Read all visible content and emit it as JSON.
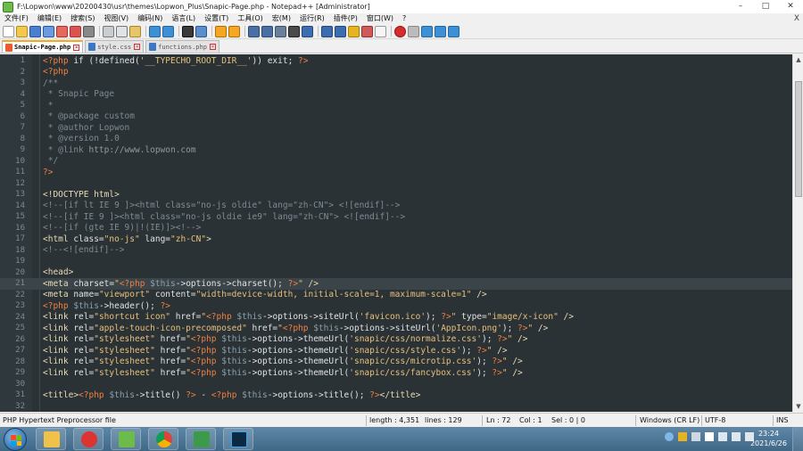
{
  "window": {
    "title": "F:\\Lopwon\\www\\20200430\\usr\\themes\\Lopwon_Plus\\Snapic-Page.php - Notepad++ [Administrator]",
    "minimize": "–",
    "maximize": "□",
    "close": "✕"
  },
  "menu": {
    "items": [
      "文件(F)",
      "编辑(E)",
      "搜索(S)",
      "视图(V)",
      "编码(N)",
      "语言(L)",
      "设置(T)",
      "工具(O)",
      "宏(M)",
      "运行(R)",
      "插件(P)",
      "窗口(W)",
      "?"
    ],
    "close": "X"
  },
  "tabs": [
    {
      "label": "Snapic-Page.php",
      "active": true,
      "icon_color": "#e85c30"
    },
    {
      "label": "style.css",
      "active": false,
      "icon_color": "#3b78c4"
    },
    {
      "label": "functions.php",
      "active": false,
      "icon_color": "#3b78c4"
    }
  ],
  "editor": {
    "current_line": 21,
    "lines": [
      {
        "n": "1",
        "segs": [
          [
            "<?php",
            "#f08040"
          ],
          [
            " if (!defined(",
            "#e0e2e4"
          ],
          [
            "'__TYPECHO_ROOT_DIR__'",
            "#e6c07b"
          ],
          [
            ")) exit; ",
            "#e0e2e4"
          ],
          [
            "?>",
            "#f08040"
          ]
        ]
      },
      {
        "n": "2",
        "segs": [
          [
            "<?php",
            "#f08040"
          ]
        ]
      },
      {
        "n": "3",
        "segs": [
          [
            "/**",
            "#7d8b94"
          ]
        ]
      },
      {
        "n": "4",
        "segs": [
          [
            " * Snapic Page",
            "#7d8b94"
          ]
        ]
      },
      {
        "n": "5",
        "segs": [
          [
            " *",
            "#7d8b94"
          ]
        ]
      },
      {
        "n": "6",
        "segs": [
          [
            " * @package custom",
            "#7d8b94"
          ]
        ]
      },
      {
        "n": "7",
        "segs": [
          [
            " * @author Lopwon",
            "#7d8b94"
          ]
        ]
      },
      {
        "n": "8",
        "segs": [
          [
            " * @version 1.0",
            "#7d8b94"
          ]
        ]
      },
      {
        "n": "9",
        "segs": [
          [
            " * @link ",
            "#7d8b94"
          ],
          [
            "http://www.lopwon.com",
            "#8c9aa3"
          ]
        ]
      },
      {
        "n": "10",
        "segs": [
          [
            " */",
            "#7d8b94"
          ]
        ]
      },
      {
        "n": "11",
        "segs": [
          [
            "?>",
            "#f08040"
          ]
        ]
      },
      {
        "n": "12",
        "segs": []
      },
      {
        "n": "13",
        "segs": [
          [
            "<!DOCTYPE html>",
            "#e8dcb5"
          ]
        ]
      },
      {
        "n": "14",
        "segs": [
          [
            "<!--[if lt IE 9 ]><html class=\"no-js oldie\" lang=\"zh-CN\"> <![endif]-->",
            "#7d8b94"
          ]
        ]
      },
      {
        "n": "15",
        "segs": [
          [
            "<!--[if IE 9 ]><html class=\"no-js oldie ie9\" lang=\"zh-CN\"> <![endif]-->",
            "#7d8b94"
          ]
        ]
      },
      {
        "n": "16",
        "segs": [
          [
            "<!--[if (gte IE 9)|!(IE)]><!-->",
            "#7d8b94"
          ]
        ]
      },
      {
        "n": "17",
        "segs": [
          [
            "<html ",
            "#e8dcb5"
          ],
          [
            "class=",
            "#e0e2e4"
          ],
          [
            "\"no-js\"",
            "#e6c07b"
          ],
          [
            " lang=",
            "#e0e2e4"
          ],
          [
            "\"zh-CN\"",
            "#e6c07b"
          ],
          [
            ">",
            "#e8dcb5"
          ]
        ]
      },
      {
        "n": "18",
        "segs": [
          [
            "<!--<![endif]-->",
            "#7d8b94"
          ]
        ]
      },
      {
        "n": "19",
        "segs": []
      },
      {
        "n": "20",
        "segs": [
          [
            "<head>",
            "#e8dcb5"
          ]
        ]
      },
      {
        "n": "21",
        "segs": [
          [
            "<meta ",
            "#e8dcb5"
          ],
          [
            "charset=",
            "#e0e2e4"
          ],
          [
            "\"",
            "#e6c07b"
          ],
          [
            "<?php",
            "#f08040"
          ],
          [
            " $this",
            "#8aa0ad"
          ],
          [
            "->options->charset(); ",
            "#e0e2e4"
          ],
          [
            "?>",
            "#f08040"
          ],
          [
            "\"",
            "#e6c07b"
          ],
          [
            " />",
            "#e8dcb5"
          ]
        ]
      },
      {
        "n": "22",
        "segs": [
          [
            "<meta ",
            "#e8dcb5"
          ],
          [
            "name=",
            "#e0e2e4"
          ],
          [
            "\"viewport\"",
            "#e6c07b"
          ],
          [
            " content=",
            "#e0e2e4"
          ],
          [
            "\"width=device-width, initial-scale=1, maximum-scale=1\"",
            "#e6c07b"
          ],
          [
            " />",
            "#e8dcb5"
          ]
        ]
      },
      {
        "n": "23",
        "segs": [
          [
            "<?php",
            "#f08040"
          ],
          [
            " $this",
            "#8aa0ad"
          ],
          [
            "->header(); ",
            "#e0e2e4"
          ],
          [
            "?>",
            "#f08040"
          ]
        ]
      },
      {
        "n": "24",
        "segs": [
          [
            "<link ",
            "#e8dcb5"
          ],
          [
            "rel=",
            "#e0e2e4"
          ],
          [
            "\"shortcut icon\"",
            "#e6c07b"
          ],
          [
            " href=",
            "#e0e2e4"
          ],
          [
            "\"",
            "#e6c07b"
          ],
          [
            "<?php",
            "#f08040"
          ],
          [
            " $this",
            "#8aa0ad"
          ],
          [
            "->options->siteUrl(",
            "#e0e2e4"
          ],
          [
            "'favicon.ico'",
            "#e6c07b"
          ],
          [
            "); ",
            "#e0e2e4"
          ],
          [
            "?>",
            "#f08040"
          ],
          [
            "\"",
            "#e6c07b"
          ],
          [
            " type=",
            "#e0e2e4"
          ],
          [
            "\"image/x-icon\"",
            "#e6c07b"
          ],
          [
            " />",
            "#e8dcb5"
          ]
        ]
      },
      {
        "n": "25",
        "segs": [
          [
            "<link ",
            "#e8dcb5"
          ],
          [
            "rel=",
            "#e0e2e4"
          ],
          [
            "\"apple-touch-icon-precomposed\"",
            "#e6c07b"
          ],
          [
            " href=",
            "#e0e2e4"
          ],
          [
            "\"",
            "#e6c07b"
          ],
          [
            "<?php",
            "#f08040"
          ],
          [
            " $this",
            "#8aa0ad"
          ],
          [
            "->options->siteUrl(",
            "#e0e2e4"
          ],
          [
            "'AppIcon.png'",
            "#e6c07b"
          ],
          [
            "); ",
            "#e0e2e4"
          ],
          [
            "?>",
            "#f08040"
          ],
          [
            "\"",
            "#e6c07b"
          ],
          [
            " />",
            "#e8dcb5"
          ]
        ]
      },
      {
        "n": "26",
        "segs": [
          [
            "<link ",
            "#e8dcb5"
          ],
          [
            "rel=",
            "#e0e2e4"
          ],
          [
            "\"stylesheet\"",
            "#e6c07b"
          ],
          [
            " href=",
            "#e0e2e4"
          ],
          [
            "\"",
            "#e6c07b"
          ],
          [
            "<?php",
            "#f08040"
          ],
          [
            " $this",
            "#8aa0ad"
          ],
          [
            "->options->themeUrl(",
            "#e0e2e4"
          ],
          [
            "'snapic/css/normalize.css'",
            "#e6c07b"
          ],
          [
            "); ",
            "#e0e2e4"
          ],
          [
            "?>",
            "#f08040"
          ],
          [
            "\"",
            "#e6c07b"
          ],
          [
            " />",
            "#e8dcb5"
          ]
        ]
      },
      {
        "n": "27",
        "segs": [
          [
            "<link ",
            "#e8dcb5"
          ],
          [
            "rel=",
            "#e0e2e4"
          ],
          [
            "\"stylesheet\"",
            "#e6c07b"
          ],
          [
            " href=",
            "#e0e2e4"
          ],
          [
            "\"",
            "#e6c07b"
          ],
          [
            "<?php",
            "#f08040"
          ],
          [
            " $this",
            "#8aa0ad"
          ],
          [
            "->options->themeUrl(",
            "#e0e2e4"
          ],
          [
            "'snapic/css/style.css'",
            "#e6c07b"
          ],
          [
            "); ",
            "#e0e2e4"
          ],
          [
            "?>",
            "#f08040"
          ],
          [
            "\"",
            "#e6c07b"
          ],
          [
            " />",
            "#e8dcb5"
          ]
        ]
      },
      {
        "n": "28",
        "segs": [
          [
            "<link ",
            "#e8dcb5"
          ],
          [
            "rel=",
            "#e0e2e4"
          ],
          [
            "\"stylesheet\"",
            "#e6c07b"
          ],
          [
            " href=",
            "#e0e2e4"
          ],
          [
            "\"",
            "#e6c07b"
          ],
          [
            "<?php",
            "#f08040"
          ],
          [
            " $this",
            "#8aa0ad"
          ],
          [
            "->options->themeUrl(",
            "#e0e2e4"
          ],
          [
            "'snapic/css/microtip.css'",
            "#e6c07b"
          ],
          [
            "); ",
            "#e0e2e4"
          ],
          [
            "?>",
            "#f08040"
          ],
          [
            "\"",
            "#e6c07b"
          ],
          [
            " />",
            "#e8dcb5"
          ]
        ]
      },
      {
        "n": "29",
        "segs": [
          [
            "<link ",
            "#e8dcb5"
          ],
          [
            "rel=",
            "#e0e2e4"
          ],
          [
            "\"stylesheet\"",
            "#e6c07b"
          ],
          [
            " href=",
            "#e0e2e4"
          ],
          [
            "\"",
            "#e6c07b"
          ],
          [
            "<?php",
            "#f08040"
          ],
          [
            " $this",
            "#8aa0ad"
          ],
          [
            "->options->themeUrl(",
            "#e0e2e4"
          ],
          [
            "'snapic/css/fancybox.css'",
            "#e6c07b"
          ],
          [
            "); ",
            "#e0e2e4"
          ],
          [
            "?>",
            "#f08040"
          ],
          [
            "\"",
            "#e6c07b"
          ],
          [
            " />",
            "#e8dcb5"
          ]
        ]
      },
      {
        "n": "30",
        "segs": []
      },
      {
        "n": "31",
        "segs": [
          [
            "<title>",
            "#e8dcb5"
          ],
          [
            "<?php",
            "#f08040"
          ],
          [
            " $this",
            "#8aa0ad"
          ],
          [
            "->title() ",
            "#e0e2e4"
          ],
          [
            "?>",
            "#f08040"
          ],
          [
            " - ",
            "#e0e2e4"
          ],
          [
            "<?php",
            "#f08040"
          ],
          [
            " $this",
            "#8aa0ad"
          ],
          [
            "->options->title(); ",
            "#e0e2e4"
          ],
          [
            "?>",
            "#f08040"
          ],
          [
            "</title>",
            "#e8dcb5"
          ]
        ]
      },
      {
        "n": "32",
        "segs": []
      }
    ]
  },
  "status": {
    "lang": "PHP Hypertext Preprocessor file",
    "length": "length : 4,351",
    "lines": "lines : 129",
    "ln": "Ln : 72",
    "col": "Col : 1",
    "sel": "Sel : 0 | 0",
    "eol": "Windows (CR LF)",
    "encoding": "UTF-8",
    "mode": "INS"
  },
  "taskbar": {
    "time": "23:24",
    "date": "2021/6/26"
  }
}
